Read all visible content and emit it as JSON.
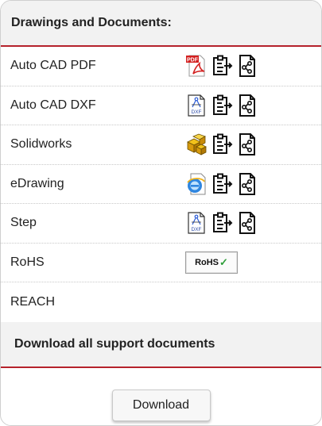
{
  "drawings": {
    "title": "Drawings and Documents:",
    "rows": [
      {
        "label": "Auto CAD PDF",
        "icons": [
          "pdf-file-icon",
          "clipboard-copy-icon",
          "share-document-icon"
        ]
      },
      {
        "label": "Auto CAD DXF",
        "icons": [
          "dxf-file-icon",
          "clipboard-copy-icon",
          "share-document-icon"
        ]
      },
      {
        "label": "Solidworks",
        "icons": [
          "solidworks-file-icon",
          "clipboard-copy-icon",
          "share-document-icon"
        ]
      },
      {
        "label": "eDrawing",
        "icons": [
          "edrawing-file-icon",
          "clipboard-copy-icon",
          "share-document-icon"
        ]
      },
      {
        "label": "Step",
        "icons": [
          "step-file-icon",
          "clipboard-copy-icon",
          "share-document-icon"
        ]
      },
      {
        "label": "RoHS",
        "badge_text": "RoHS",
        "badge_check": "✓"
      },
      {
        "label": "REACH"
      }
    ]
  },
  "pdf_icon_text": "PDF",
  "dxf_icon_text": "DXF",
  "download_section": {
    "title": "Download all support documents",
    "button_label": "Download"
  },
  "colors": {
    "accent_red": "#b5222b",
    "header_bg": "#f2f2f2",
    "check_green": "#2e9e3a"
  }
}
